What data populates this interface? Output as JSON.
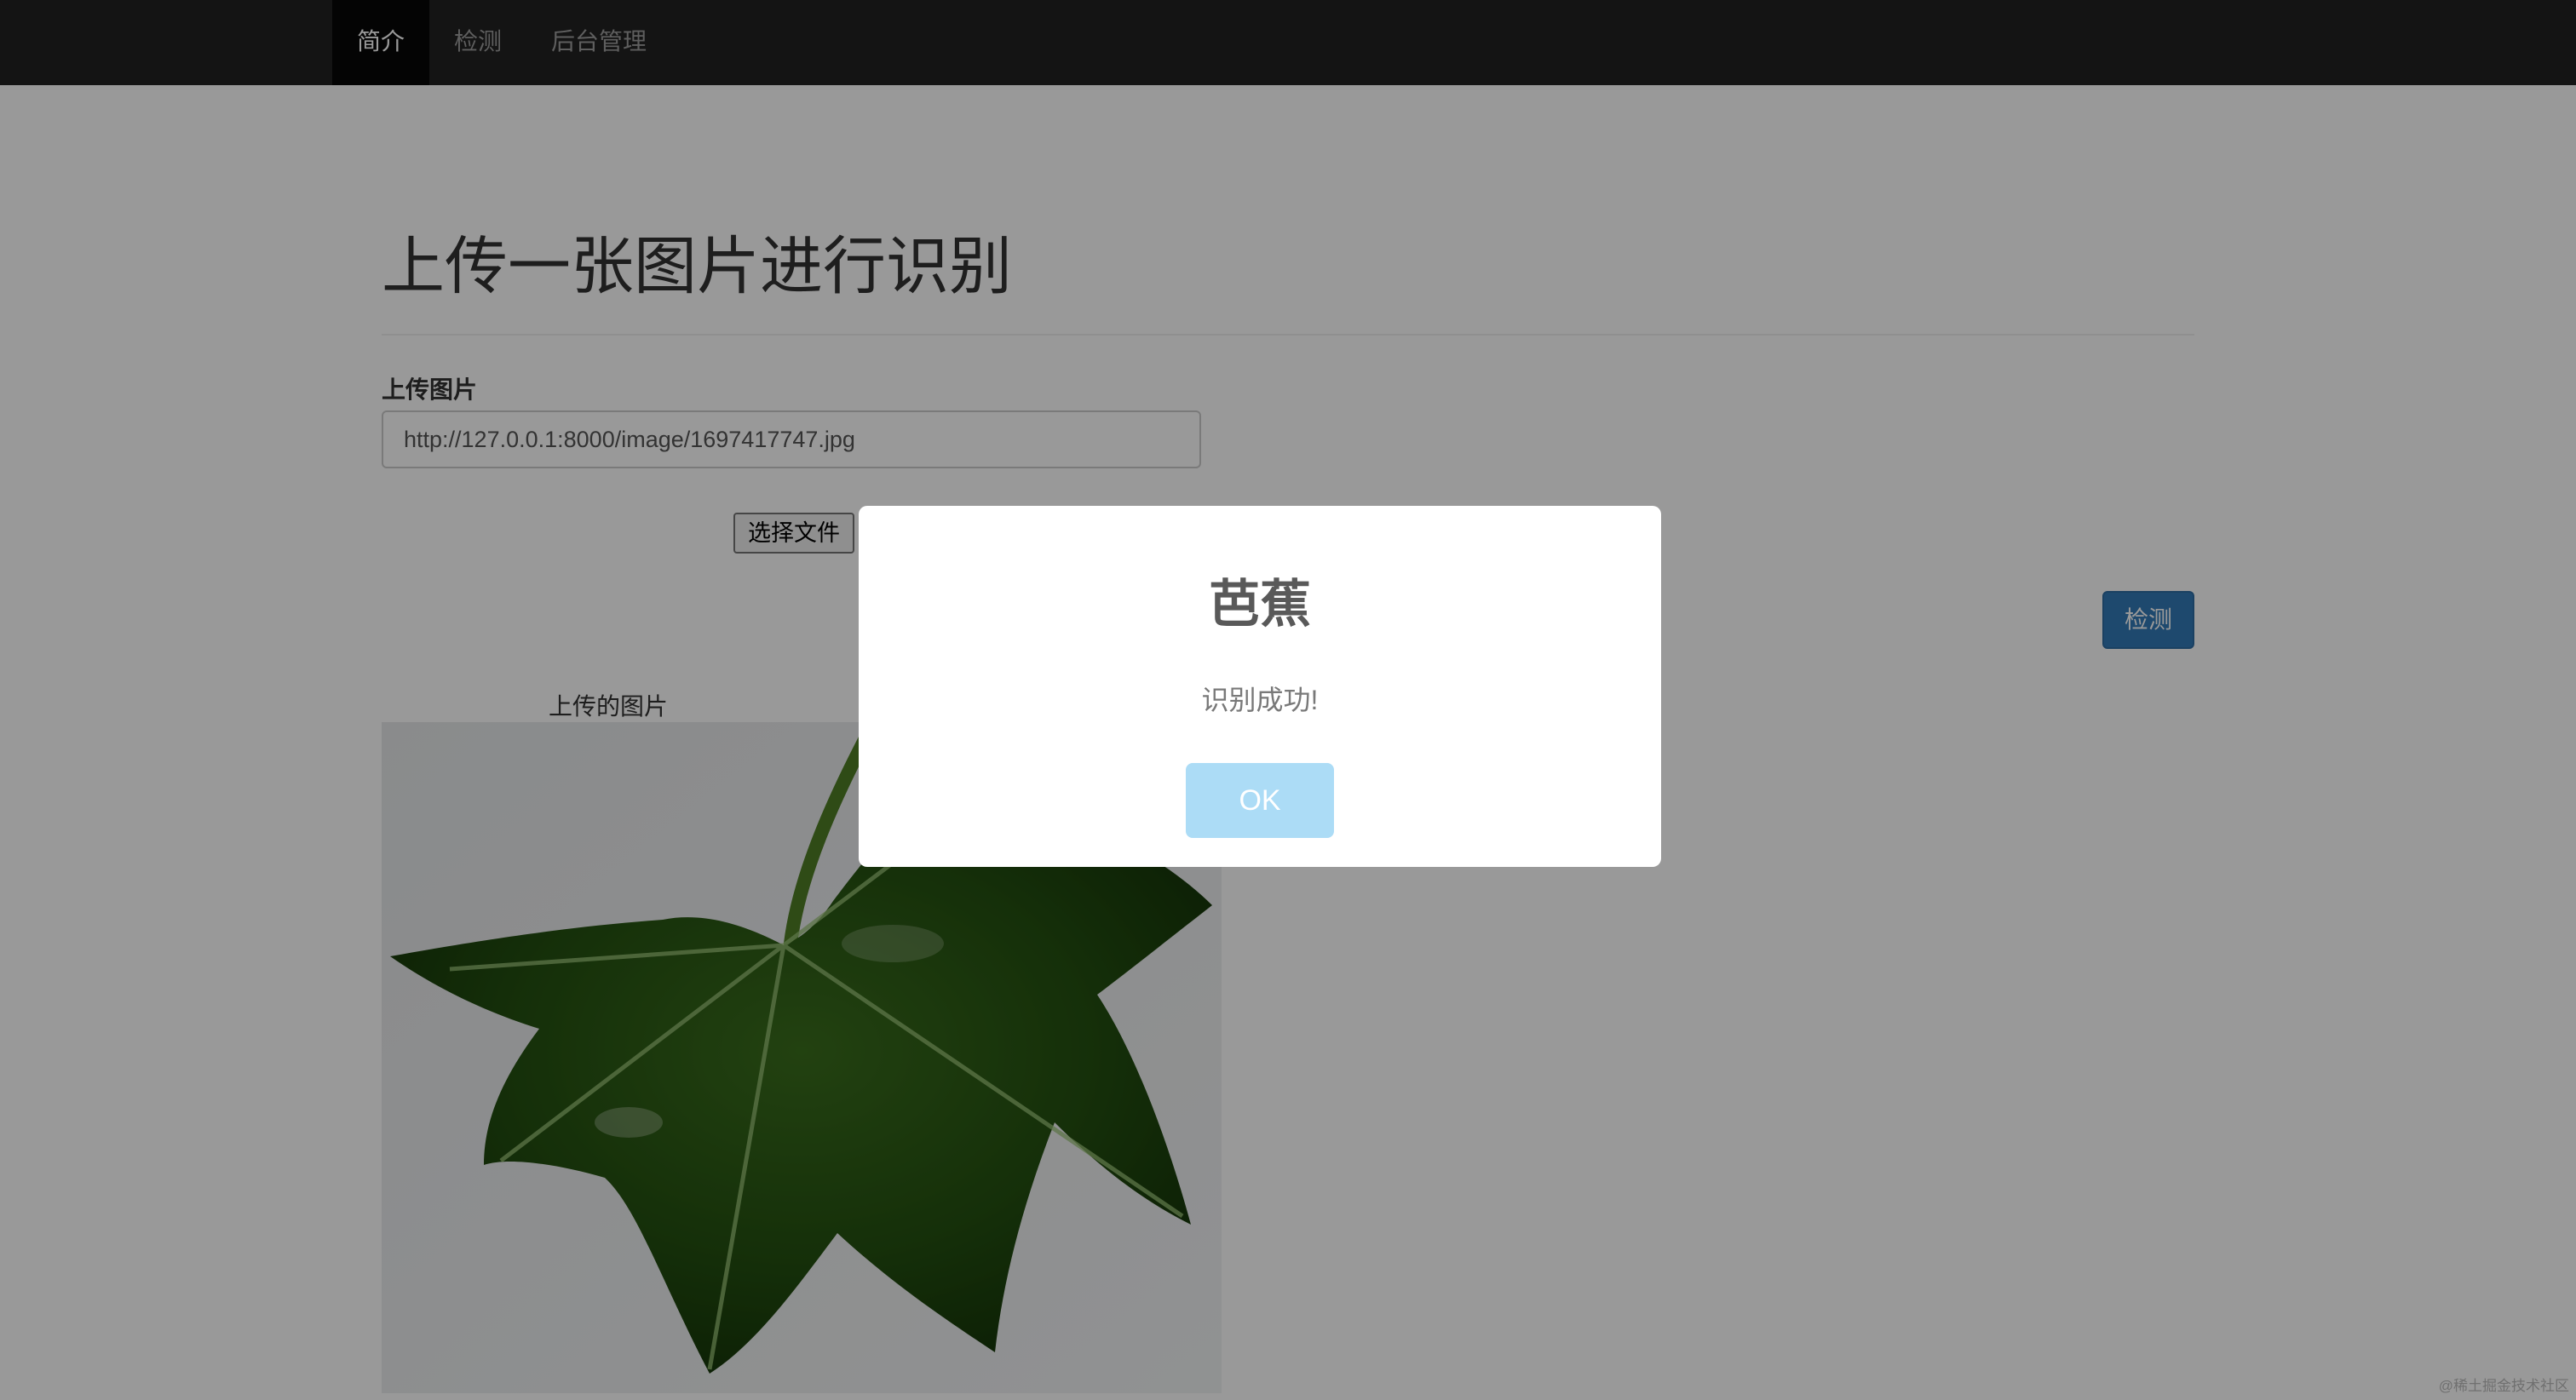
{
  "nav": {
    "items": [
      {
        "label": "简介",
        "active": true
      },
      {
        "label": "检测",
        "active": false
      },
      {
        "label": "后台管理",
        "active": false
      }
    ]
  },
  "main": {
    "title": "上传一张图片进行识别",
    "upload_label": "上传图片",
    "url_value": "http://127.0.0.1:8000/image/1697417747.jpg",
    "file_button_label": "选择文件",
    "detect_button_label": "检测",
    "image_caption": "上传的图片"
  },
  "dialog": {
    "title": "芭蕉",
    "message": "识别成功!",
    "ok_label": "OK"
  },
  "watermark": "@稀土掘金技术社区",
  "colors": {
    "navbar": "#222222",
    "nav_active": "#080808",
    "primary": "#337ab7",
    "ok_button": "#acdcf6",
    "overlay": "rgba(0,0,0,0.4)"
  }
}
